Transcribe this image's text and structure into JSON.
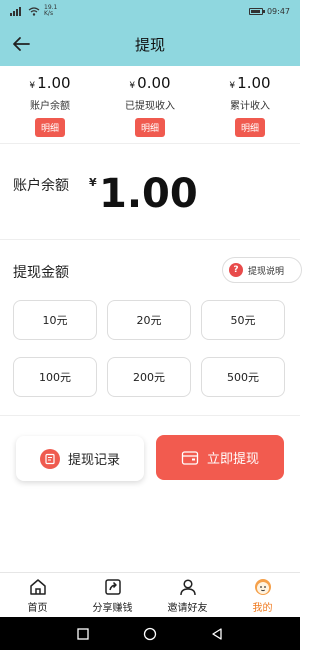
{
  "status": {
    "speed_value": "19.1",
    "speed_unit": "K/s",
    "time": "09:47"
  },
  "header": {
    "title": "提现"
  },
  "summary": [
    {
      "currency": "¥",
      "value": "1.00",
      "label": "账户余额",
      "detail": "明细"
    },
    {
      "currency": "¥",
      "value": "0.00",
      "label": "已提现收入",
      "detail": "明细"
    },
    {
      "currency": "¥",
      "value": "1.00",
      "label": "累计收入",
      "detail": "明细"
    }
  ],
  "balance": {
    "label": "账户余额",
    "currency": "¥",
    "amount": "1.00"
  },
  "withdraw": {
    "title": "提现金额",
    "explain": "提现说明",
    "amounts": [
      "10元",
      "20元",
      "50元",
      "100元",
      "200元",
      "500元"
    ]
  },
  "actions": {
    "record": "提现记录",
    "withdraw_now": "立即提现"
  },
  "tabs": [
    {
      "label": "首页",
      "icon": "home-icon"
    },
    {
      "label": "分享赚钱",
      "icon": "share-icon"
    },
    {
      "label": "邀请好友",
      "icon": "user-icon"
    },
    {
      "label": "我的",
      "icon": "profile-face-icon",
      "active": true
    }
  ],
  "colors": {
    "header": "#8fd7df",
    "accent": "#f25b4f",
    "tab_active": "#f07a1f"
  }
}
